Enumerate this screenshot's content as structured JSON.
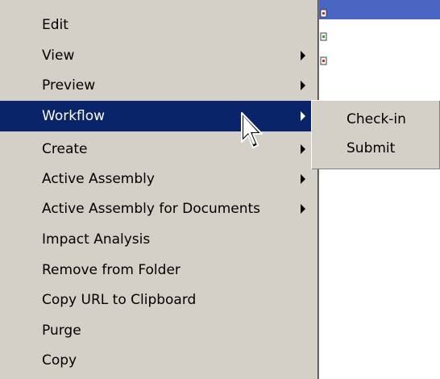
{
  "menu": {
    "items": [
      {
        "label": "Edit",
        "has_submenu": false
      },
      {
        "label": "View",
        "has_submenu": true
      },
      {
        "label": "Preview",
        "has_submenu": true
      },
      {
        "label": "Workflow",
        "has_submenu": true,
        "selected": true
      },
      {
        "label": "Create",
        "has_submenu": true
      },
      {
        "label": "Active Assembly",
        "has_submenu": true
      },
      {
        "label": "Active Assembly for Documents",
        "has_submenu": true
      },
      {
        "label": "Impact Analysis",
        "has_submenu": false
      },
      {
        "label": "Remove from Folder",
        "has_submenu": false
      },
      {
        "label": "Copy URL to Clipboard",
        "has_submenu": false
      },
      {
        "label": "Purge",
        "has_submenu": false
      },
      {
        "label": "Copy",
        "has_submenu": false
      }
    ]
  },
  "submenu": {
    "items": [
      {
        "label": "Check-in"
      },
      {
        "label": "Submit"
      }
    ]
  },
  "colors": {
    "menu_bg": "#d4d0c8",
    "selection_bg": "#0a246a",
    "selection_text": "#ffffff",
    "list_highlight": "#4a66c2"
  },
  "icons": {
    "background_rows": "document-icon",
    "pointer": "mouse-pointer-icon",
    "submenu_indicator": "submenu-arrow-icon"
  }
}
